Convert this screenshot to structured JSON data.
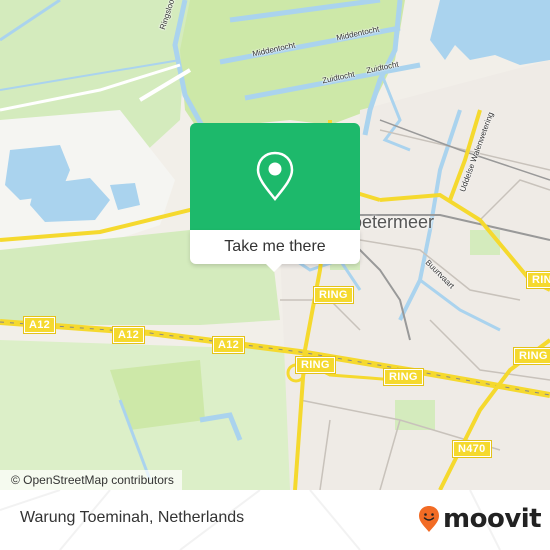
{
  "map": {
    "city_label": "Zoetermeer",
    "city_label_visible": "etermeer",
    "street_labels": {
      "ringsloot": "Ringsloot",
      "middentocht_1": "Middentocht",
      "middentocht_2": "Middentocht",
      "zuidtocht_1": "Zuidtocht",
      "zuidtocht_2": "Zuidtocht",
      "walenweg": "Uddelse Walenwetering",
      "buurtvaart": "Buurtvaart"
    },
    "road_shields": {
      "a12_1": "A12",
      "a12_2": "A12",
      "a12_3": "A12",
      "ring_1": "RING",
      "ring_2": "RING",
      "ring_3": "RING",
      "ring_4": "RING",
      "ring_5": "RING",
      "n470": "N470"
    },
    "colors": {
      "land": "#f2efe9",
      "green": "#cde8b0",
      "water": "#aad3ee",
      "road_major": "#f5d92e",
      "accent": "#1db96b"
    }
  },
  "popup": {
    "icon": "map-pin-icon",
    "action_label": "Take me there"
  },
  "attribution": {
    "text": "© OpenStreetMap contributors"
  },
  "footer": {
    "place_name": "Warung Toeminah, Netherlands",
    "brand": "moovit",
    "brand_color": "#f26b24"
  }
}
